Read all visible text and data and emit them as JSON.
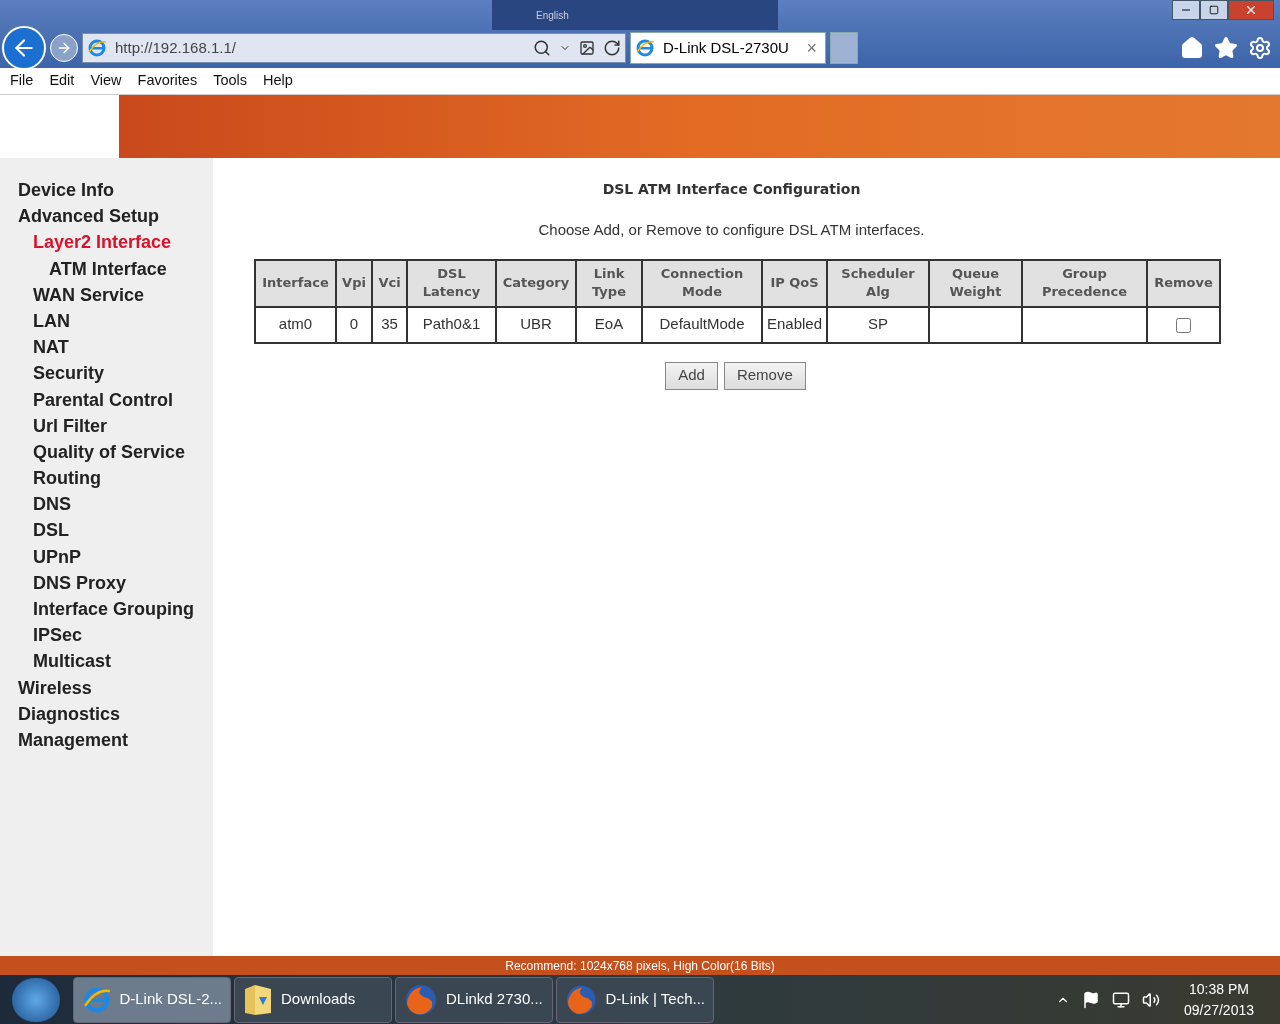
{
  "language_bar": {
    "label": "English"
  },
  "browser": {
    "address": "http://192.168.1.1/",
    "tab": {
      "title": "D-Link DSL-2730U",
      "close": "×"
    }
  },
  "menu_bar": [
    "File",
    "Edit",
    "View",
    "Favorites",
    "Tools",
    "Help"
  ],
  "sidebar": {
    "items": [
      {
        "label": "Device Info",
        "selected": false
      },
      {
        "label": "Advanced Setup",
        "selected": false,
        "children": [
          {
            "label": "Layer2 Interface",
            "selected": true,
            "children": [
              {
                "label": "ATM Interface",
                "selected": false
              }
            ]
          },
          {
            "label": "WAN Service",
            "selected": false
          },
          {
            "label": "LAN",
            "selected": false
          },
          {
            "label": "NAT",
            "selected": false
          },
          {
            "label": "Security",
            "selected": false
          },
          {
            "label": "Parental Control",
            "selected": false
          },
          {
            "label": "Url Filter",
            "selected": false
          },
          {
            "label": "Quality of Service",
            "selected": false
          },
          {
            "label": "Routing",
            "selected": false
          },
          {
            "label": "DNS",
            "selected": false
          },
          {
            "label": "DSL",
            "selected": false
          },
          {
            "label": "UPnP",
            "selected": false
          },
          {
            "label": "DNS Proxy",
            "selected": false
          },
          {
            "label": "Interface Grouping",
            "selected": false
          },
          {
            "label": "IPSec",
            "selected": false
          },
          {
            "label": "Multicast",
            "selected": false
          }
        ]
      },
      {
        "label": "Wireless",
        "selected": false
      },
      {
        "label": "Diagnostics",
        "selected": false
      },
      {
        "label": "Management",
        "selected": false
      }
    ]
  },
  "content": {
    "title": "DSL ATM Interface Configuration",
    "subtitle": "Choose Add, or Remove to configure DSL ATM interfaces.",
    "table": {
      "columns": [
        "Interface",
        "Vpi",
        "Vci",
        "DSL\nLatency",
        "Category",
        "Link\nType",
        "Connection\nMode",
        "IP QoS",
        "Scheduler\nAlg",
        "Queue\nWeight",
        "Group\nPrecedence",
        "Remove"
      ],
      "rows": [
        {
          "cells": [
            "atm0",
            "0",
            "35",
            "Path0&1",
            "UBR",
            "EoA",
            "DefaultMode",
            "Enabled",
            "SP",
            "",
            ""
          ],
          "remove_checked": false
        }
      ]
    },
    "buttons": [
      "Add",
      "Remove"
    ]
  },
  "status_bar": "Recommend: 1024x768 pixels, High Color(16 Bits)",
  "taskbar": {
    "items": [
      {
        "label": "D-Link DSL-2...",
        "kind": "ie",
        "selected": true
      },
      {
        "label": "Downloads",
        "kind": "folder",
        "selected": false
      },
      {
        "label": "DLinkd 2730...",
        "kind": "firefox",
        "selected": false
      },
      {
        "label": "D-Link | Tech...",
        "kind": "firefox",
        "selected": false
      }
    ],
    "time": "10:38 PM",
    "date": "09/27/2013"
  }
}
